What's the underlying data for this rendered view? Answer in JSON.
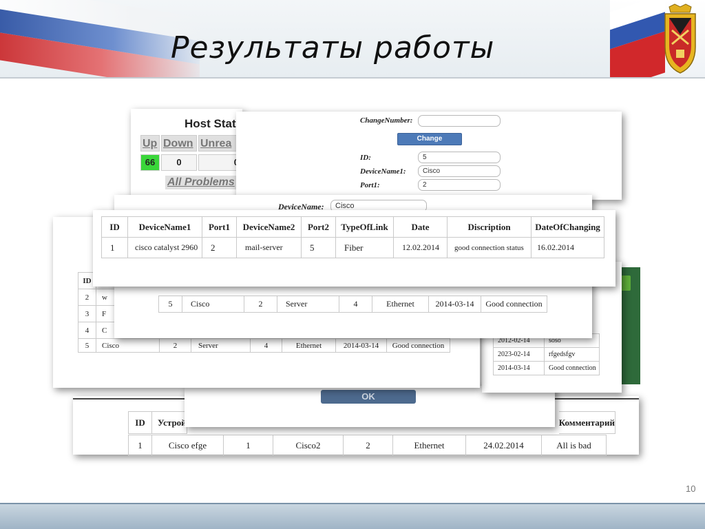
{
  "header": {
    "title": "Результаты работы",
    "page_number": "10"
  },
  "host_status": {
    "title": "Host Stat",
    "tabs": [
      "Up",
      "Down",
      "Unrea"
    ],
    "values": [
      "66",
      "0",
      "0"
    ],
    "all_problems": "All Problems"
  },
  "change_form": {
    "changenumber_label": "ChangeNumber:",
    "changenumber_value": "",
    "change_button": "Change",
    "id_label": "ID:",
    "id_value": "5",
    "devicename1_label": "DeviceName1:",
    "devicename1_value": "Cisco",
    "port1_label": "Port1:",
    "port1_value": "2"
  },
  "devicename_form": {
    "label": "DeviceName:",
    "value": "Cisco"
  },
  "main_table": {
    "headers": [
      "ID",
      "DeviceName1",
      "Port1",
      "DeviceName2",
      "Port2",
      "TypeOfLink",
      "Date",
      "Discription",
      "DateOfChanging"
    ],
    "rows": [
      [
        "1",
        "cisco catalyst 2960",
        "2",
        "mail-server",
        "5",
        "Fiber",
        "12.02.2014",
        "good connection status",
        "16.02.2014"
      ]
    ]
  },
  "list_panel": {
    "header_id": "ID",
    "rows": [
      {
        "id": "2",
        "name": "w"
      },
      {
        "id": "3",
        "name": "F"
      },
      {
        "id": "4",
        "name": "C"
      },
      {
        "id": "5",
        "name": "Cisco",
        "port1": "2",
        "device2": "Server",
        "port2": "4",
        "type": "Ethernet",
        "date": "2014-03-14",
        "desc": "Good connection"
      }
    ]
  },
  "second_table": {
    "row": [
      "5",
      "Cisco",
      "2",
      "Server",
      "4",
      "Ethernet",
      "2014-03-14",
      "Good connection"
    ]
  },
  "right_table": {
    "rows": [
      [
        "2012-02-14",
        "soso"
      ],
      [
        "2023-02-14",
        "rfgedsfgv"
      ],
      [
        "2014-03-14",
        "Good connection"
      ]
    ]
  },
  "ok_button": "OK",
  "bottom_table": {
    "headers": [
      "ID",
      "Устрой",
      "Комментарий"
    ],
    "row": [
      "1",
      "Cisco efge",
      "1",
      "Cisco2",
      "2",
      "Ethernet",
      "24.02.2014",
      "All is bad"
    ]
  },
  "colors": {
    "up_green": "#3ad63a",
    "button_blue": "#4d7ab8",
    "dark_green": "#2e6a3a"
  }
}
